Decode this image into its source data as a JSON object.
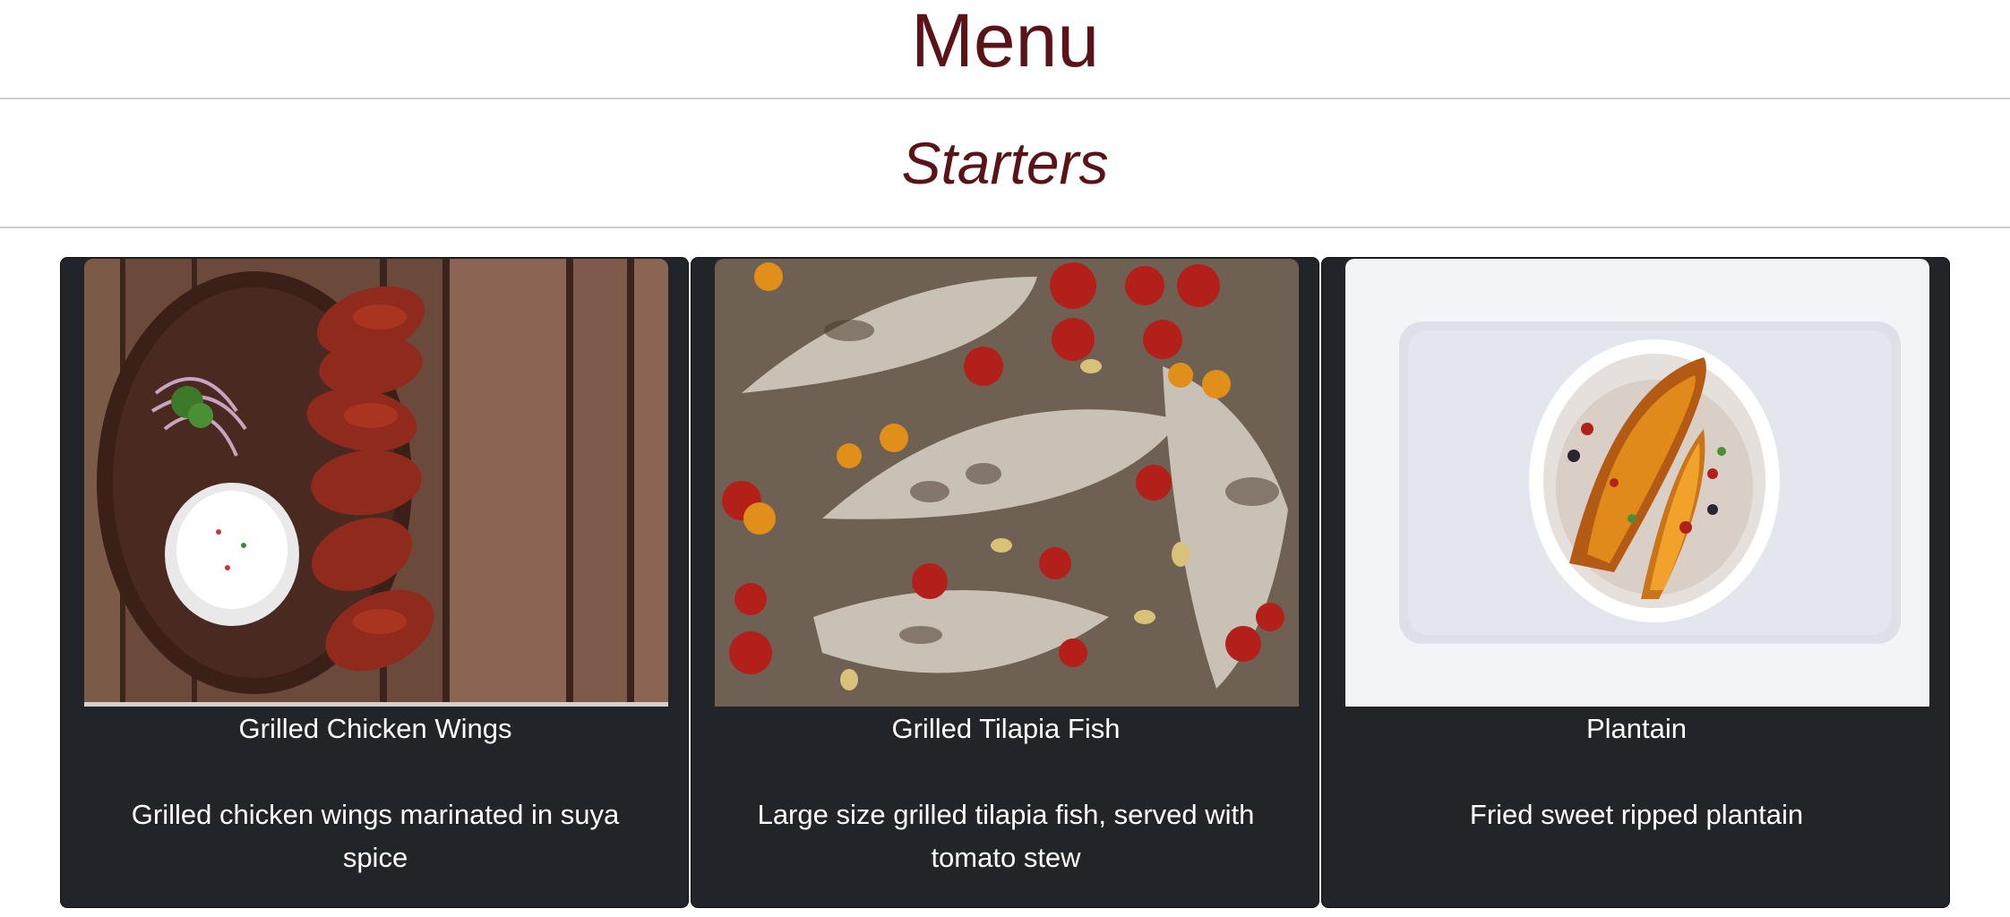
{
  "header": {
    "title": "Menu"
  },
  "section": {
    "title": "Starters"
  },
  "colors": {
    "heading": "#5a1418",
    "card_bg": "#212529",
    "card_text": "#ffffff"
  },
  "items": [
    {
      "name": "Grilled Chicken Wings",
      "description": "Grilled chicken wings marinated in suya spice",
      "image": "chicken-wings-photo"
    },
    {
      "name": "Grilled Tilapia Fish",
      "description": "Large size grilled tilapia fish, served with tomato stew",
      "image": "tilapia-fish-photo"
    },
    {
      "name": "Plantain",
      "description": "Fried sweet ripped plantain",
      "image": "plantain-photo"
    }
  ]
}
